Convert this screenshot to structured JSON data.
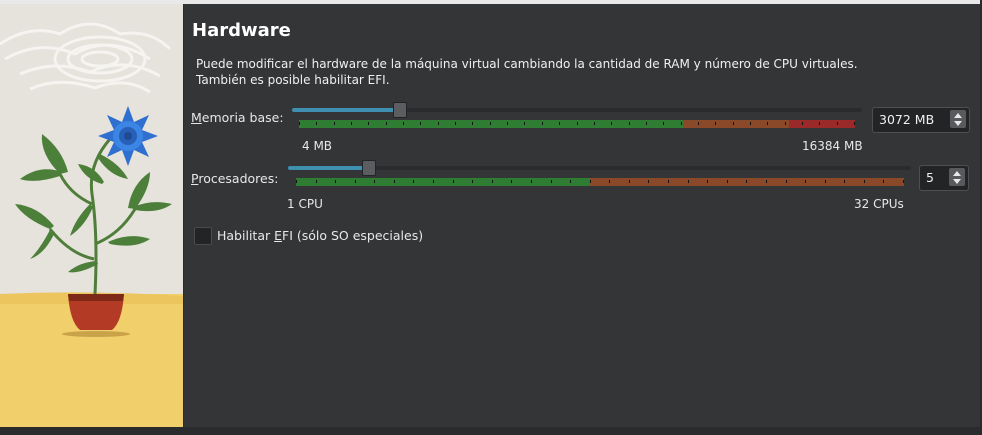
{
  "page": {
    "title": "Hardware",
    "description_line1": "Puede modificar el hardware de la máquina virtual cambiando la cantidad de RAM y número de CPU virtuales.",
    "description_line2": "También es posible habilitar EFI."
  },
  "memory": {
    "label_pre": "",
    "label_accel": "M",
    "label_post": "emoria base:",
    "min_label": "4 MB",
    "max_label": "16384 MB",
    "value": "3072 MB",
    "fraction": 0.1875
  },
  "cpu": {
    "label_pre": "",
    "label_accel": "P",
    "label_post": "rocesadores:",
    "min_label": "1 CPU",
    "max_label": "32 CPUs",
    "value": "5",
    "fraction": 0.129
  },
  "efi": {
    "label_pre": "Habilitar ",
    "label_accel": "E",
    "label_post": "FI (sólo SO especiales)",
    "checked": false
  },
  "colors": {
    "slider_fill": "#3e8fb0",
    "scale_green": "#2f7d32",
    "scale_orange": "#8a4a2a",
    "scale_red": "#9a2a2a"
  }
}
